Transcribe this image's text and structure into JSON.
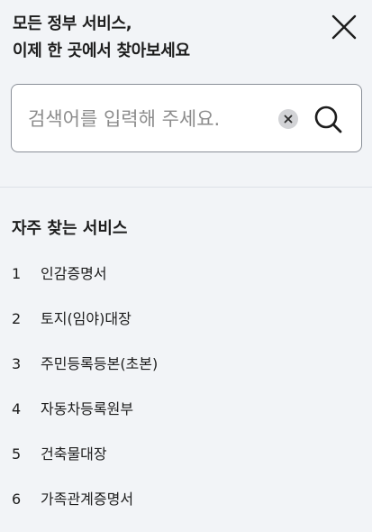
{
  "header": {
    "line1": "모든 정부 서비스,",
    "line2": "이제 한 곳에서 찾아보세요"
  },
  "icons": {
    "close": "close-icon",
    "clear": "clear-icon",
    "search": "search-icon"
  },
  "search": {
    "placeholder": "검색어를 입력해 주세요.",
    "value": ""
  },
  "popular": {
    "title": "자주 찾는 서비스",
    "items": [
      {
        "rank": "1",
        "label": "인감증명서"
      },
      {
        "rank": "2",
        "label": "토지(임야)대장"
      },
      {
        "rank": "3",
        "label": "주민등록등본(초본)"
      },
      {
        "rank": "4",
        "label": "자동차등록원부"
      },
      {
        "rank": "5",
        "label": "건축물대장"
      },
      {
        "rank": "6",
        "label": "가족관계증명서"
      }
    ]
  },
  "colors": {
    "background": "#f2f4f7",
    "search_box": "#ffffff",
    "search_border": "#8a8f98",
    "text": "#1d1d1d",
    "placeholder": "#8c8c8c",
    "clear_bg": "#d2d3d6"
  }
}
